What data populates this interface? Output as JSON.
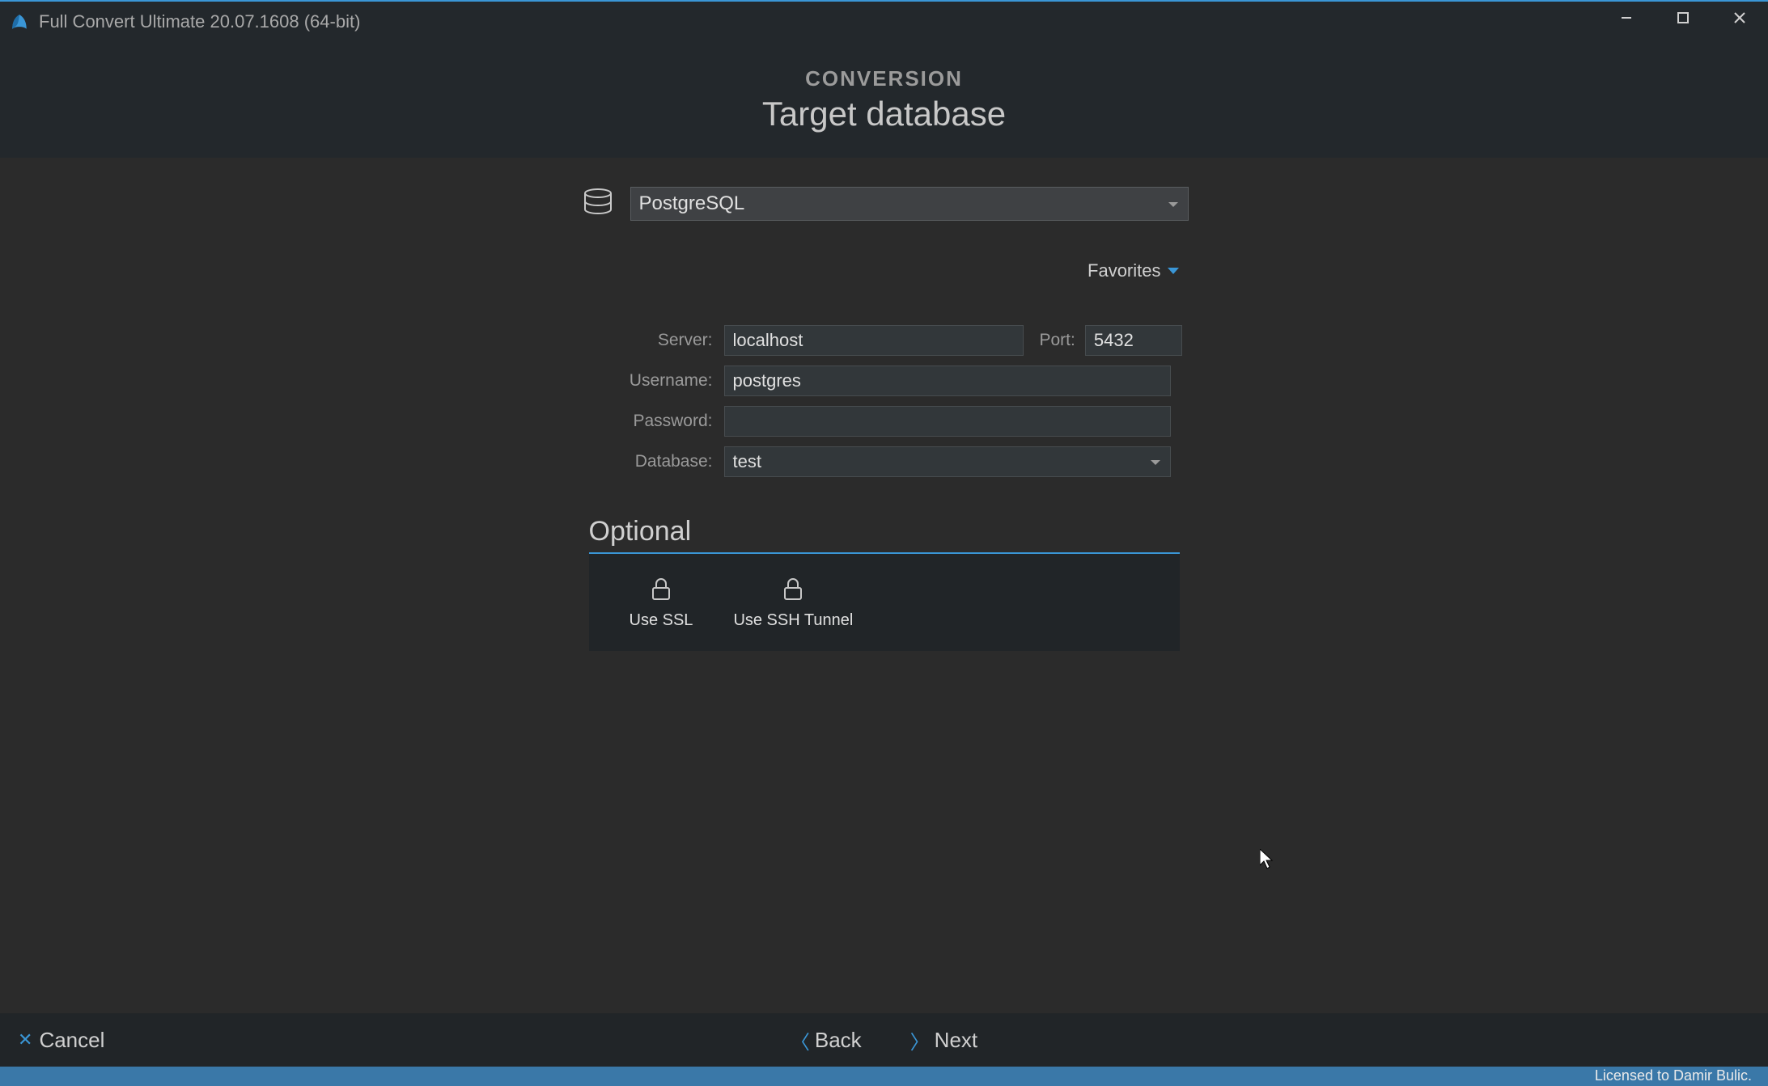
{
  "titleBar": {
    "appTitle": "Full Convert Ultimate 20.07.1608 (64-bit)"
  },
  "header": {
    "section": "CONVERSION",
    "subtitle": "Target database"
  },
  "dbSelect": {
    "value": "PostgreSQL"
  },
  "favorites": {
    "label": "Favorites"
  },
  "form": {
    "serverLabel": "Server:",
    "serverValue": "localhost",
    "portLabel": "Port:",
    "portValue": "5432",
    "usernameLabel": "Username:",
    "usernameValue": "postgres",
    "passwordLabel": "Password:",
    "passwordValue": "",
    "databaseLabel": "Database:",
    "databaseValue": "test"
  },
  "optional": {
    "title": "Optional",
    "ssl": "Use SSL",
    "ssh": "Use SSH Tunnel"
  },
  "footer": {
    "cancel": "Cancel",
    "back": "Back",
    "next": "Next"
  },
  "statusBar": {
    "license": "Licensed to Damir Bulic."
  }
}
